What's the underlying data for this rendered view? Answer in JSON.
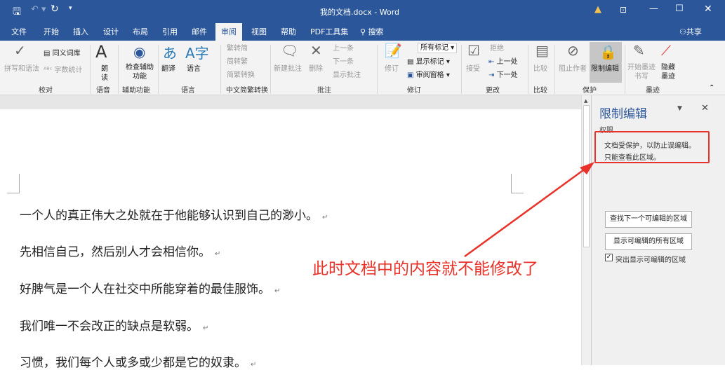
{
  "title_bar": {
    "title": "我的文档.docx - Word",
    "save_icon": "save-icon",
    "undo_icon": "undo-icon",
    "redo_icon": "redo-icon"
  },
  "tabs": [
    "文件",
    "开始",
    "插入",
    "设计",
    "布局",
    "引用",
    "邮件",
    "审阅",
    "视图",
    "帮助",
    "PDF工具集"
  ],
  "search_label": "搜索",
  "share_label": "共享",
  "ribbon": {
    "spell": "拼写和语法",
    "thesaurus": "同义词库",
    "wordcount": "字数统计",
    "read_aloud": "朗读",
    "check_access": "检查辅助功能",
    "translate": "翻译",
    "language": "语言",
    "t2s": "繁转简",
    "s2t": "简转繁",
    "convert": "简繁转换",
    "new_comment": "新建批注",
    "delete": "删除",
    "prev": "上一条",
    "next": "下一条",
    "show_comments": "显示批注",
    "track": "修订",
    "markup_select": "所有标记",
    "show_markup": "显示标记",
    "review_pane": "审阅窗格",
    "accept": "接受",
    "reject": "拒绝",
    "prev_change": "上一处",
    "next_change": "下一处",
    "compare": "比较",
    "block_authors": "阻止作者",
    "restrict": "限制编辑",
    "start_ink": "开始墨迹书写",
    "hide_ink": "隐藏墨迹",
    "groups": [
      "校对",
      "语音",
      "辅助功能",
      "语言",
      "中文简繁转换",
      "批注",
      "修订",
      "更改",
      "比较",
      "保护",
      "墨迹"
    ]
  },
  "document": {
    "lines": [
      "一个人的真正伟大之处就在于他能够认识到自己的渺小。",
      "先相信自己，然后别人才会相信你。",
      "好脾气是一个人在社交中所能穿着的最佳服饰。",
      "我们唯一不会改正的缺点是软弱。",
      "习惯，我们每个人或多或少都是它的奴隶。"
    ],
    "paragraph_mark": "↵"
  },
  "annotation": "此时文档中的内容就不能修改了",
  "pane": {
    "title": "限制编辑",
    "section": "权限",
    "message1": "文档受保护，以防止误编辑。",
    "message2": "只能查看此区域。",
    "find_next": "查找下一个可编辑的区域",
    "show_all": "显示可编辑的所有区域",
    "highlight": "突出显示可编辑的区域",
    "highlight_checked": true
  },
  "colors": {
    "brand": "#2b579a",
    "annotation": "#e8322a"
  }
}
